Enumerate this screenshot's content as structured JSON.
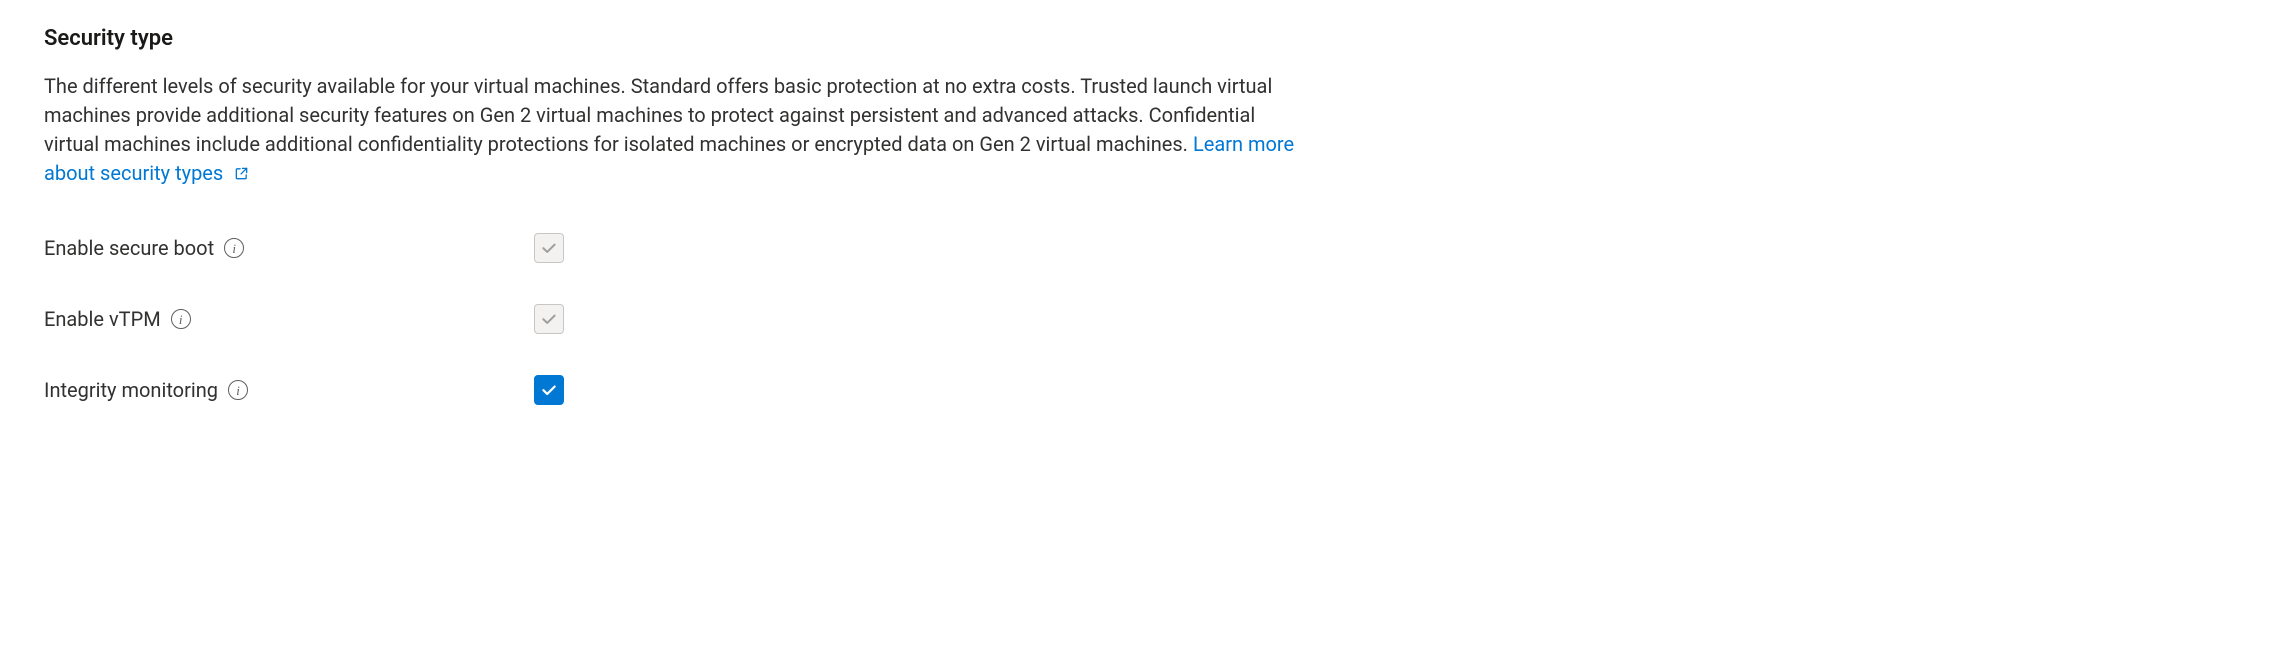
{
  "section": {
    "title": "Security type",
    "description": "The different levels of security available for your virtual machines. Standard offers basic protection at no extra costs. Trusted launch virtual machines provide additional security features on Gen 2 virtual machines to protect against persistent and advanced attacks. Confidential virtual machines include additional confidentiality protections for isolated machines or encrypted data on Gen 2 virtual machines.",
    "link_label": "Learn more about security types"
  },
  "fields": {
    "secure_boot": {
      "label": "Enable secure boot",
      "checked": true,
      "disabled": true
    },
    "vtpm": {
      "label": "Enable vTPM",
      "checked": true,
      "disabled": true
    },
    "integrity": {
      "label": "Integrity monitoring",
      "checked": true,
      "disabled": false
    }
  },
  "colors": {
    "link": "#0078d4",
    "accent": "#0078d4",
    "text": "#323130"
  }
}
